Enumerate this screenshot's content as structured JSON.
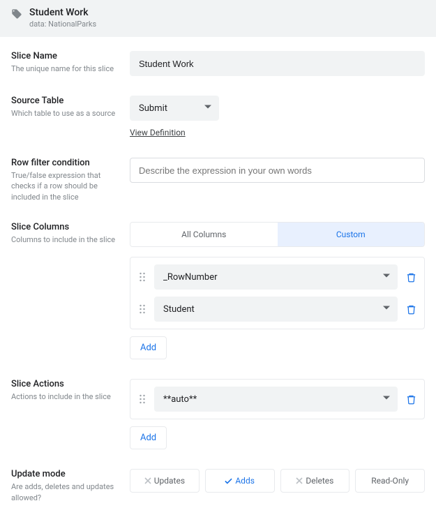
{
  "header": {
    "title": "Student Work",
    "data_prefix": "data:",
    "data_source": "NationalParks"
  },
  "slice_name": {
    "label": "Slice Name",
    "desc": "The unique name for this slice",
    "value": "Student Work"
  },
  "source_table": {
    "label": "Source Table",
    "desc": "Which table to use as a source",
    "value": "Submit",
    "view_definition": "View Definition"
  },
  "row_filter": {
    "label": "Row filter condition",
    "desc": "True/false expression that checks if a row should be included in the slice",
    "placeholder": "Describe the expression in your own words"
  },
  "slice_columns": {
    "label": "Slice Columns",
    "desc": "Columns to include in the slice",
    "tabs": {
      "all": "All Columns",
      "custom": "Custom"
    },
    "items": [
      "_RowNumber",
      "Student"
    ],
    "add": "Add"
  },
  "slice_actions": {
    "label": "Slice Actions",
    "desc": "Actions to include in the slice",
    "items": [
      "**auto**"
    ],
    "add": "Add"
  },
  "update_mode": {
    "label": "Update mode",
    "desc": "Are adds, deletes and updates allowed?",
    "options": {
      "updates": "Updates",
      "adds": "Adds",
      "deletes": "Deletes",
      "readonly": "Read-Only"
    }
  }
}
